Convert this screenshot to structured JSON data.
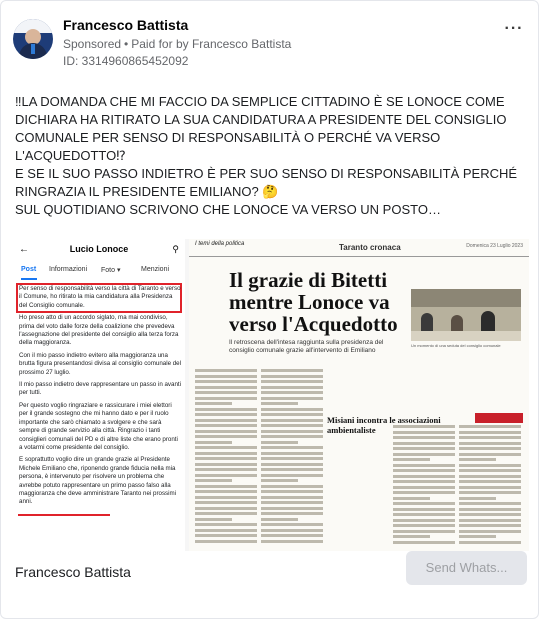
{
  "ad": {
    "page_name": "Francesco Battista",
    "sponsored_label": "Sponsored",
    "paid_for_by": "Paid for by Francesco Battista",
    "ad_id": "ID: 3314960865452092",
    "more_icon": "more-horizontal-icon",
    "body_lines": [
      "‼LA DOMANDA CHE MI FACCIO DA SEMPLICE CITTADINO È SE LONOCE COME DICHIARA HA RITIRATO LA SUA CANDIDATURA A PRESIDENTE DEL CONSIGLIO COMUNALE PER SENSO DI RESPONSABILITÀ O PERCHÉ VA VERSO L'ACQUEDOTTO⁉",
      "E SE IL SUO PASSO INDIETRO È PER SUO SENSO DI RESPONSABILITÀ PERCHÉ RINGRAZIA IL PRESIDENTE EMILIANO? 🤔",
      "SUL QUOTIDIANO SCRIVONO CHE LONOCE VA VERSO UN POSTO…"
    ],
    "footer_name": "Francesco Battista",
    "cta_label": "Send Whats..."
  },
  "phone_screenshot": {
    "title": "Lucio Lonoce",
    "tabs": [
      "Post",
      "Informazioni",
      "Foto ▾",
      "Menzioni"
    ],
    "paragraphs": [
      "Per senso di responsabilità verso la città di Taranto e verso il Comune, ho ritirato la mia candidatura alla Presidenza del Consiglio comunale.",
      "Ho preso atto di un accordo siglato, ma mai condiviso, prima del voto dalle forze della coalizione che prevedeva l'assegnazione del presidente del consiglio alla terza forza della maggioranza.",
      "Con il mio passo indietro evitero alla maggioranza una brutta figura presentandosi divisa al consiglio comunale del prossimo 27 luglio.",
      "Il mio passo indietro deve rappresentare un passo in avanti per tutti.",
      "Per questo voglio ringraziare e rassicurare i miei elettori per il grande sostegno che mi hanno dato e per il ruolo importante che sarò chiamato a svolgere e che sarà sempre di grande servizio alla città. Ringrazio i tanti consiglieri comunali del PD e di altre liste che erano pronti a votarmi come presidente del consiglio.",
      "E soprattutto voglio dire un grande grazie al Presidente Michele Emiliano che, riponendo grande fiducia nella mia persona, è intervenuto per risolvere un problema che avrebbe potuto rappresentare un primo passo falso alla maggioranza che deve amministrare Taranto nei prossimi anni."
    ]
  },
  "newspaper": {
    "section": "I temi della politica",
    "header": "Taranto cronaca",
    "date": "Domenica 23 Luglio 2023",
    "headline": "Il grazie di Bitetti mentre Lonoce va verso l'Acquedotto",
    "deck": "Il retroscena dell'intesa raggiunta sulla presidenza del consiglio comunale grazie all'intervento di Emiliano",
    "subheadline": "Misiani incontra le associazioni ambientaliste",
    "photo_caption": "Un momento di una seduta del consiglio comunale"
  }
}
